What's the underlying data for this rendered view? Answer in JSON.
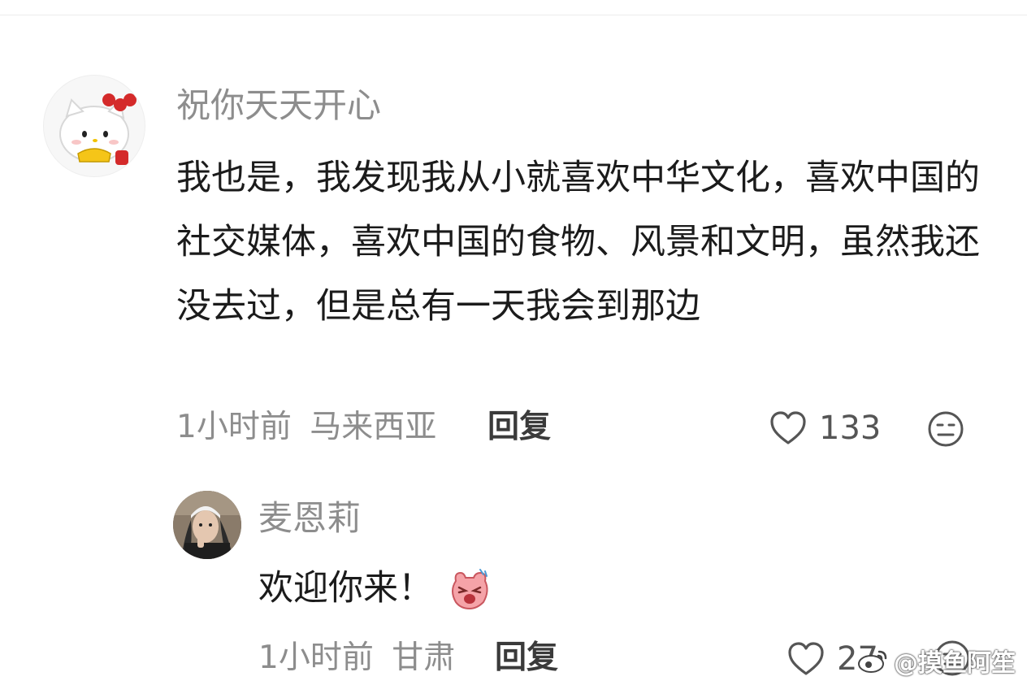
{
  "comment1": {
    "username": "祝你天天开心",
    "text": "我也是，我发现我从小就喜欢中华文化，喜欢中国的社交媒体，喜欢中国的食物、风景和文明，虽然我还没去过，但是总有一天我会到那边",
    "time": "1小时前",
    "location": "马来西亚",
    "reply_label": "回复",
    "like_count": "133",
    "avatar_icon": "hello-kitty-avatar",
    "like_icon": "heart-outline-icon",
    "dislike_icon": "meh-face-icon"
  },
  "comment2": {
    "username": "麦恩莉",
    "text": "欢迎你来！",
    "emoji_icon": "pink-laughing-emoji",
    "time": "1小时前",
    "location": "甘肃",
    "reply_label": "回复",
    "like_count": "27",
    "avatar_icon": "woman-portrait-avatar",
    "like_icon": "heart-outline-icon",
    "dislike_icon": "meh-face-icon"
  },
  "watermark": {
    "text": "@摸鱼阿笙",
    "icon": "weibo-logo-icon"
  }
}
